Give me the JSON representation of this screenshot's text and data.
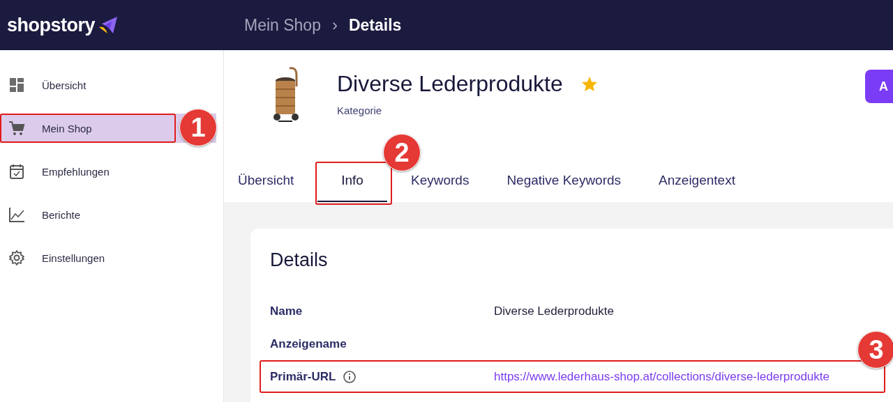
{
  "header": {
    "brand": "shopstory",
    "breadcrumb": [
      {
        "label": "Mein Shop",
        "current": false
      },
      {
        "label": "Details",
        "current": true
      }
    ],
    "separator": "›"
  },
  "sidebar": {
    "items": [
      {
        "label": "Übersicht",
        "selected": false
      },
      {
        "label": "Mein Shop",
        "selected": true,
        "callout": "1"
      },
      {
        "label": "Empfehlungen",
        "selected": false
      },
      {
        "label": "Berichte",
        "selected": false
      },
      {
        "label": "Einstellungen",
        "selected": false
      }
    ]
  },
  "product": {
    "title": "Diverse Lederprodukte",
    "favorite": true,
    "subtitle": "Kategorie",
    "action_button": "A"
  },
  "tabs": [
    {
      "label": "Übersicht",
      "selected": false
    },
    {
      "label": "Info",
      "selected": true,
      "callout": "2"
    },
    {
      "label": "Keywords",
      "selected": false
    },
    {
      "label": "Negative Keywords",
      "selected": false
    },
    {
      "label": "Anzeigentext",
      "selected": false
    }
  ],
  "details": {
    "title": "Details",
    "rows": [
      {
        "label": "Name",
        "value": "Diverse Lederprodukte",
        "kind": "text",
        "info": false
      },
      {
        "label": "Anzeigename",
        "info": false
      },
      {
        "label": "Primär-URL",
        "value": "https://www.lederhaus-shop.at/collections/diverse-lederprodukte",
        "kind": "link",
        "info": true,
        "callout": "3"
      }
    ]
  }
}
